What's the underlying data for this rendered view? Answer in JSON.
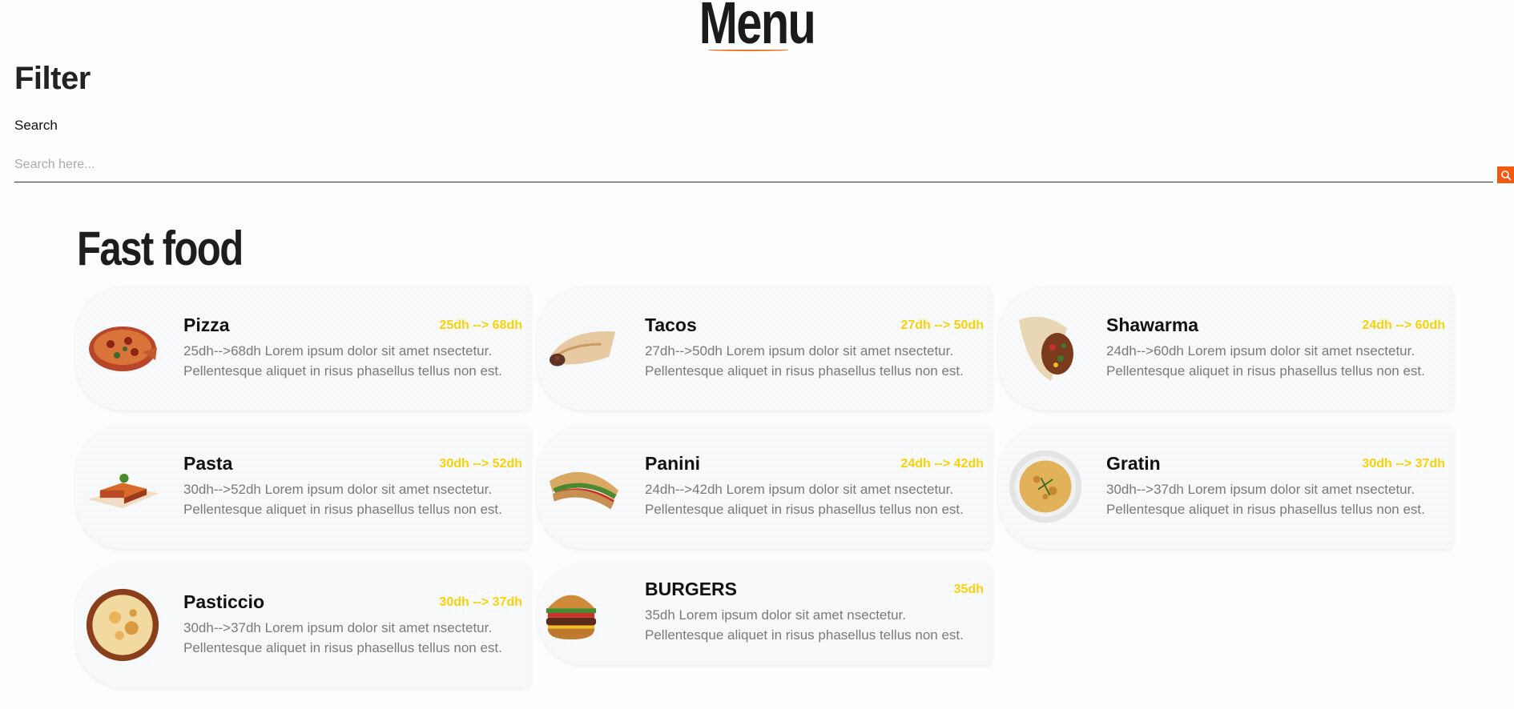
{
  "header": {
    "title": "Menu"
  },
  "filter": {
    "title": "Filter",
    "search_label": "Search",
    "search_placeholder": "Search here...",
    "search_value": ""
  },
  "section": {
    "title": "Fast food"
  },
  "items": [
    {
      "name": "Pizza",
      "price": "25dh --> 68dh",
      "desc_1": "25dh-->68dh Lorem ipsum dolor sit amet nsectetur.",
      "desc_2": "Pellentesque aliquet in risus phasellus tellus non est.",
      "icon": "pizza-image"
    },
    {
      "name": "Tacos",
      "price": "27dh --> 50dh",
      "desc_1": "27dh-->50dh Lorem ipsum dolor sit amet nsectetur.",
      "desc_2": "Pellentesque aliquet in risus phasellus tellus non est.",
      "icon": "tacos-image"
    },
    {
      "name": "Shawarma",
      "price": "24dh --> 60dh",
      "desc_1": "24dh-->60dh Lorem ipsum dolor sit amet nsectetur.",
      "desc_2": "Pellentesque aliquet in risus phasellus tellus non est.",
      "icon": "shawarma-image"
    },
    {
      "name": "Pasta",
      "price": "30dh --> 52dh",
      "desc_1": "30dh-->52dh Lorem ipsum dolor sit amet nsectetur.",
      "desc_2": "Pellentesque aliquet in risus phasellus tellus non est.",
      "icon": "pasta-image"
    },
    {
      "name": "Panini",
      "price": "24dh --> 42dh",
      "desc_1": "24dh-->42dh Lorem ipsum dolor sit amet nsectetur.",
      "desc_2": "Pellentesque aliquet in risus phasellus tellus non est.",
      "icon": "panini-image"
    },
    {
      "name": "Gratin",
      "price": "30dh --> 37dh",
      "desc_1": "30dh-->37dh Lorem ipsum dolor sit amet nsectetur.",
      "desc_2": "Pellentesque aliquet in risus phasellus tellus non est.",
      "icon": "gratin-image"
    },
    {
      "name": "Pasticcio",
      "price": "30dh --> 37dh",
      "desc_1": "30dh-->37dh Lorem ipsum dolor sit amet nsectetur.",
      "desc_2": "Pellentesque aliquet in risus phasellus tellus non est.",
      "icon": "pasticcio-image"
    },
    {
      "name": "BURGERS",
      "price": "35dh",
      "desc_1": "35dh Lorem ipsum dolor sit amet nsectetur.",
      "desc_2": "Pellentesque aliquet in risus phasellus tellus non est.",
      "icon": "burger-image"
    }
  ],
  "colors": {
    "accent": "#f15a10",
    "price": "#f7d20a",
    "underline": "#ee7a2f"
  }
}
